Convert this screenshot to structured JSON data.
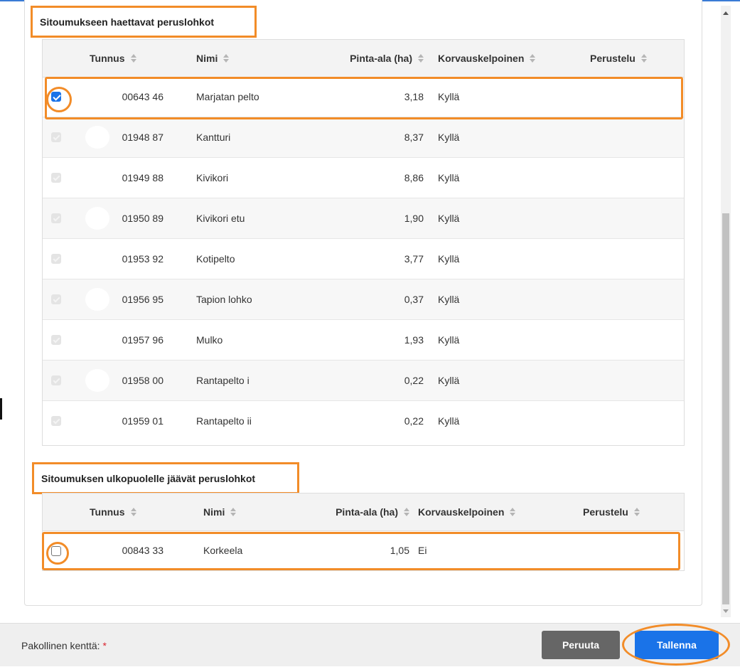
{
  "section1": {
    "title": "Sitoumukseen haettavat peruslohkot",
    "columns": {
      "tunnus": "Tunnus",
      "nimi": "Nimi",
      "pinta_ala": "Pinta-ala (ha)",
      "korvauskelpoinen": "Korvauskelpoinen",
      "perustelu": "Perustelu"
    },
    "rows": [
      {
        "tunnus": "00643 46",
        "nimi": "Marjatan pelto",
        "pinta_ala": "3,18",
        "korvauskelpoinen": "Kyllä",
        "perustelu": "",
        "checked": true,
        "disabled": false
      },
      {
        "tunnus": "01948 87",
        "nimi": "Kantturi",
        "pinta_ala": "8,37",
        "korvauskelpoinen": "Kyllä",
        "perustelu": "",
        "checked": true,
        "disabled": true
      },
      {
        "tunnus": "01949 88",
        "nimi": "Kivikori",
        "pinta_ala": "8,86",
        "korvauskelpoinen": "Kyllä",
        "perustelu": "",
        "checked": true,
        "disabled": true
      },
      {
        "tunnus": "01950 89",
        "nimi": "Kivikori etu",
        "pinta_ala": "1,90",
        "korvauskelpoinen": "Kyllä",
        "perustelu": "",
        "checked": true,
        "disabled": true
      },
      {
        "tunnus": "01953 92",
        "nimi": "Kotipelto",
        "pinta_ala": "3,77",
        "korvauskelpoinen": "Kyllä",
        "perustelu": "",
        "checked": true,
        "disabled": true
      },
      {
        "tunnus": "01956 95",
        "nimi": "Tapion lohko",
        "pinta_ala": "0,37",
        "korvauskelpoinen": "Kyllä",
        "perustelu": "",
        "checked": true,
        "disabled": true
      },
      {
        "tunnus": "01957 96",
        "nimi": "Mulko",
        "pinta_ala": "1,93",
        "korvauskelpoinen": "Kyllä",
        "perustelu": "",
        "checked": true,
        "disabled": true
      },
      {
        "tunnus": "01958 00",
        "nimi": "Rantapelto i",
        "pinta_ala": "0,22",
        "korvauskelpoinen": "Kyllä",
        "perustelu": "",
        "checked": true,
        "disabled": true
      },
      {
        "tunnus": "01959 01",
        "nimi": "Rantapelto ii",
        "pinta_ala": "0,22",
        "korvauskelpoinen": "Kyllä",
        "perustelu": "",
        "checked": true,
        "disabled": true
      }
    ]
  },
  "section2": {
    "title": "Sitoumuksen ulkopuolelle jäävät peruslohkot",
    "columns": {
      "tunnus": "Tunnus",
      "nimi": "Nimi",
      "pinta_ala": "Pinta-ala (ha)",
      "korvauskelpoinen": "Korvauskelpoinen",
      "perustelu": "Perustelu"
    },
    "rows": [
      {
        "tunnus": "00843 33",
        "nimi": "Korkeela",
        "pinta_ala": "1,05",
        "korvauskelpoinen": "Ei",
        "perustelu": "",
        "checked": false,
        "disabled": false
      }
    ]
  },
  "footer": {
    "required_label": "Pakollinen kenttä:",
    "required_marker": "*",
    "cancel_label": "Peruuta",
    "save_label": "Tallenna"
  },
  "icons": {
    "sort": "sort-icon",
    "scroll_up": "arrow-up-icon",
    "scroll_down": "arrow-down-icon"
  },
  "colors": {
    "highlight": "#f28c28",
    "primary": "#1a73e8",
    "cancel": "#666666",
    "required": "#d9232e"
  }
}
